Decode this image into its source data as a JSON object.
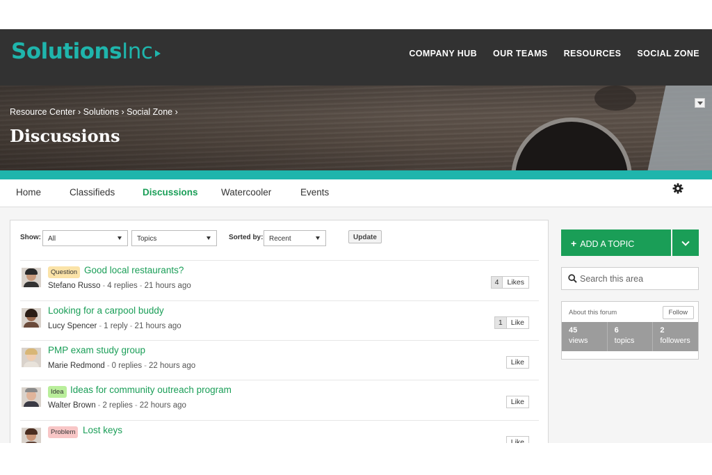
{
  "brand": {
    "name_bold": "Solutions",
    "name_light": "Inc",
    "color": "#1fb5ac"
  },
  "main_nav": [
    "COMPANY HUB",
    "OUR TEAMS",
    "RESOURCES",
    "SOCIAL ZONE"
  ],
  "breadcrumb": "Resource Center › Solutions › Social Zone ›",
  "page_title": "Discussions",
  "sub_nav": {
    "items": [
      "Home",
      "Classifieds",
      "Discussions",
      "Watercooler",
      "Events"
    ],
    "active": "Discussions"
  },
  "filters": {
    "show_label": "Show:",
    "show_value": "All",
    "type_value": "Topics",
    "sort_label": "Sorted by:",
    "sort_value": "Recent",
    "update_label": "Update"
  },
  "topics": [
    {
      "badge": "Question",
      "title": "Good local restaurants?",
      "author": "Stefano Russo",
      "replies": "4 replies",
      "time": "21 hours ago",
      "likes": "4",
      "like_label": "Likes"
    },
    {
      "badge": "",
      "title": "Looking for a carpool buddy",
      "author": "Lucy Spencer",
      "replies": "1 reply",
      "time": "21 hours ago",
      "likes": "1",
      "like_label": "Like"
    },
    {
      "badge": "",
      "title": "PMP exam study group",
      "author": "Marie Redmond",
      "replies": "0 replies",
      "time": "22 hours ago",
      "likes": "",
      "like_label": "Like"
    },
    {
      "badge": "Idea",
      "title": "Ideas for community outreach program",
      "author": "Walter Brown",
      "replies": "2 replies",
      "time": "22 hours ago",
      "likes": "",
      "like_label": "Like"
    },
    {
      "badge": "Problem",
      "title": "Lost keys",
      "author": "",
      "replies": "",
      "time": "",
      "likes": "",
      "like_label": "Like"
    }
  ],
  "sidebar": {
    "add_topic_label": "ADD A TOPIC",
    "search_placeholder": "Search this area",
    "about_label": "About this forum",
    "follow_label": "Follow",
    "stats": [
      {
        "value": "45",
        "label": "views"
      },
      {
        "value": "6",
        "label": "topics"
      },
      {
        "value": "2",
        "label": "followers"
      }
    ]
  },
  "colors": {
    "accent_green": "#1a9e57",
    "teal": "#1fb5ac",
    "topbar": "#323232"
  }
}
